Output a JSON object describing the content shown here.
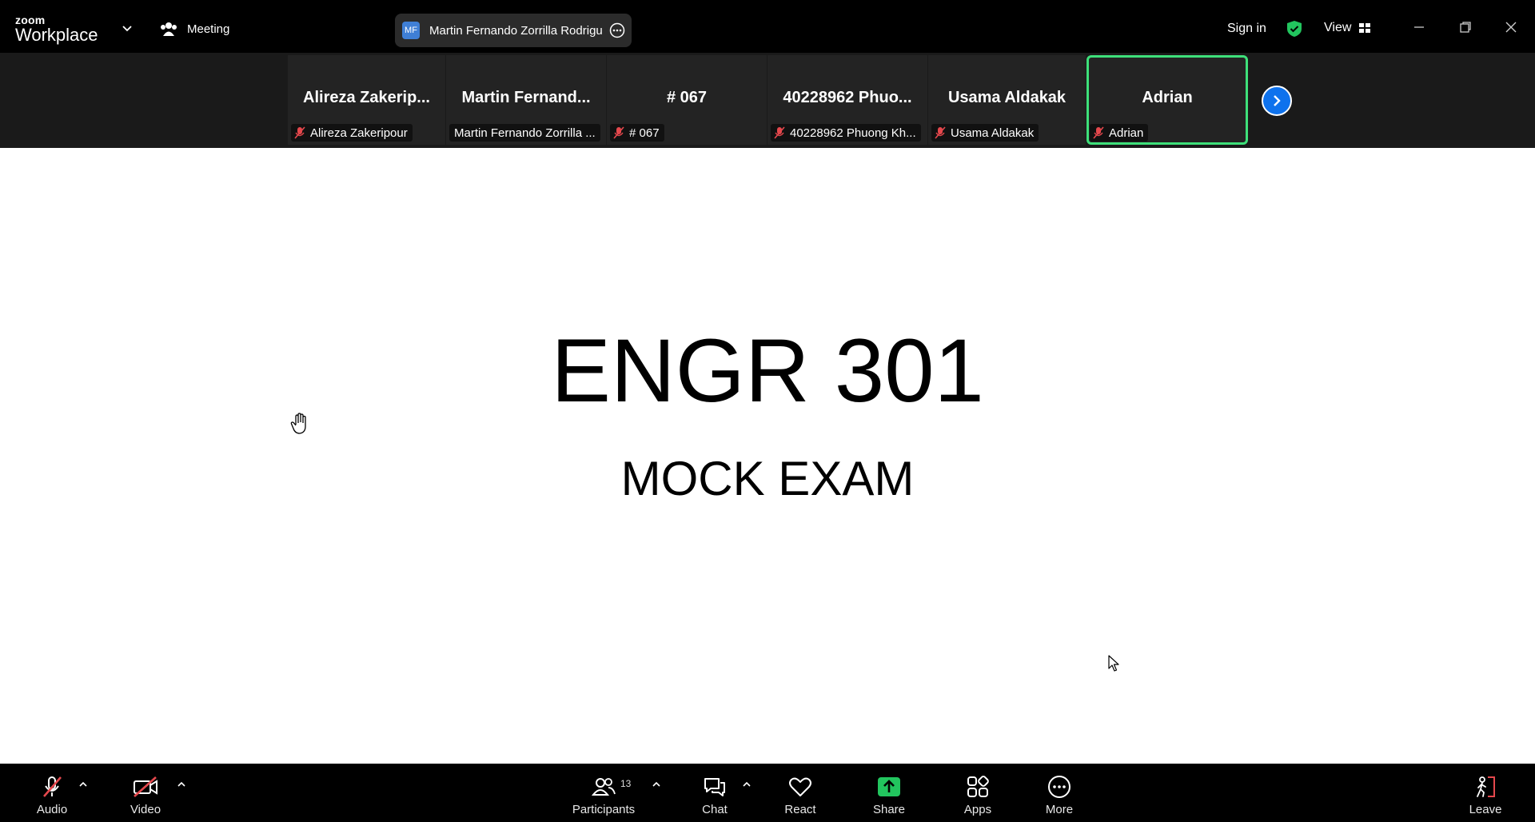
{
  "app": {
    "brand_small": "zoom",
    "brand_large": "Workplace"
  },
  "titlebar": {
    "meeting_label": "Meeting",
    "active_speaker": {
      "initials": "MF",
      "name": "Martin Fernando Zorrilla Rodrigu"
    },
    "sign_in": "Sign in",
    "view_label": "View"
  },
  "participants_strip": [
    {
      "display": "Alireza  Zakerip...",
      "tag": "Alireza Zakeripour",
      "muted": true
    },
    {
      "display": "Martin  Fernand...",
      "tag": "Martin Fernando Zorrilla ...",
      "muted": false
    },
    {
      "display": "# 067",
      "tag": "# 067",
      "muted": true
    },
    {
      "display": "40228962  Phuo...",
      "tag": "40228962 Phuong Kh...",
      "muted": true
    },
    {
      "display": "Usama Aldakak",
      "tag": "Usama Aldakak",
      "muted": true
    },
    {
      "display": "Adrian",
      "tag": "Adrian",
      "muted": true,
      "active": true
    }
  ],
  "slide": {
    "title": "ENGR 301",
    "subtitle": "MOCK EXAM"
  },
  "toolbar": {
    "audio": "Audio",
    "video": "Video",
    "participants": "Participants",
    "participant_count": "13",
    "chat": "Chat",
    "react": "React",
    "share": "Share",
    "apps": "Apps",
    "more": "More",
    "leave": "Leave"
  },
  "colors": {
    "accent_blue": "#0e72ed",
    "share_green": "#22c55e",
    "active_border": "#3ee07a",
    "muted_red": "#e5484d"
  }
}
